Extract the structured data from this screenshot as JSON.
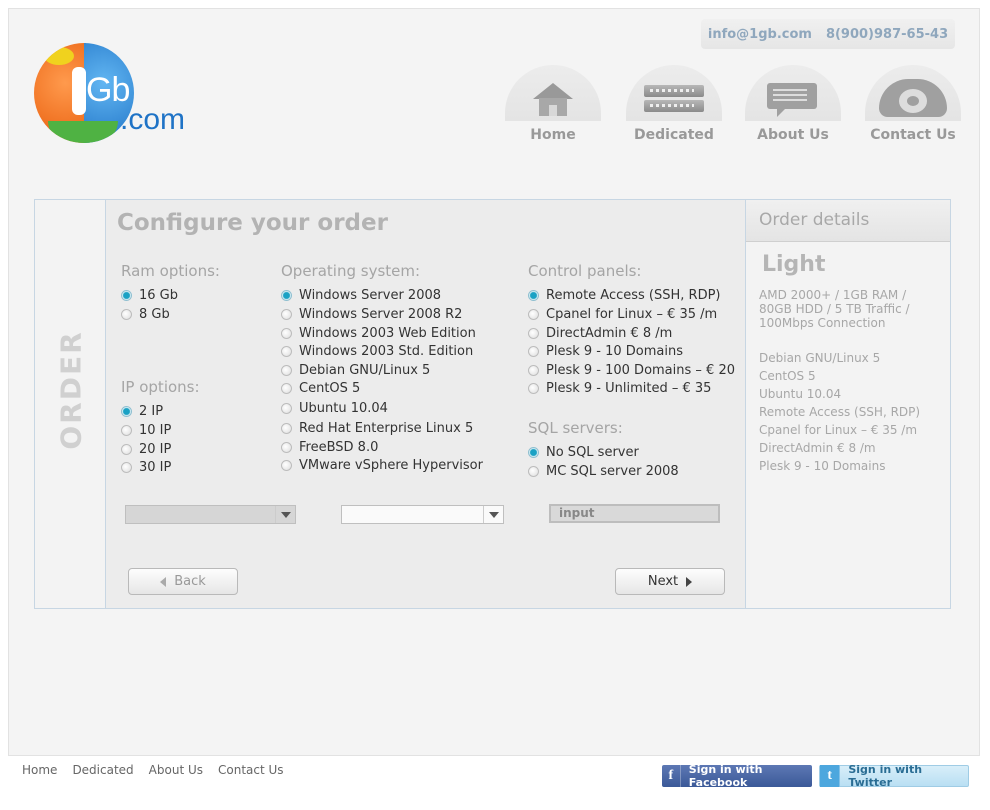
{
  "header": {
    "email": "info@1gb.com",
    "phone": "8(900)987-65-43",
    "logo_text": "1Gb.com",
    "nav": [
      {
        "label": "Home",
        "icon": "home-icon"
      },
      {
        "label": "Dedicated",
        "icon": "server-icon"
      },
      {
        "label": "About Us",
        "icon": "chat-icon"
      },
      {
        "label": "Contact Us",
        "icon": "phone-icon"
      }
    ]
  },
  "order": {
    "side_label": "ORDER",
    "title": "Configure your order",
    "ram": {
      "title": "Ram options:",
      "options": [
        {
          "label": "16 Gb",
          "selected": true
        },
        {
          "label": "8 Gb",
          "selected": false
        }
      ]
    },
    "ip": {
      "title": "IP options:",
      "options": [
        {
          "label": "2 IP",
          "selected": true
        },
        {
          "label": "10 IP",
          "selected": false
        },
        {
          "label": "20 IP",
          "selected": false
        },
        {
          "label": "30 IP",
          "selected": false
        }
      ]
    },
    "os": {
      "title": "Operating system:",
      "options": [
        {
          "label": "Windows Server 2008",
          "selected": true
        },
        {
          "label": "Windows Server 2008 R2",
          "selected": false
        },
        {
          "label": "Windows 2003 Web Edition",
          "selected": false
        },
        {
          "label": "Windows 2003 Std. Edition",
          "selected": false
        },
        {
          "label": "Debian GNU/Linux 5",
          "selected": false
        },
        {
          "label": "CentOS 5",
          "selected": false
        },
        {
          "label": "Ubuntu 10.04",
          "selected": false
        },
        {
          "label": "Red Hat Enterprise Linux 5",
          "selected": false
        },
        {
          "label": "FreeBSD 8.0",
          "selected": false
        },
        {
          "label": "VMware vSphere Hypervisor",
          "selected": false
        }
      ]
    },
    "control": {
      "title": "Control panels:",
      "options": [
        {
          "label": "Remote Access (SSH, RDP)",
          "selected": true
        },
        {
          "label": "Cpanel for Linux – € 35 /m",
          "selected": false
        },
        {
          "label": "DirectAdmin € 8 /m",
          "selected": false
        },
        {
          "label": "Plesk 9 - 10 Domains",
          "selected": false
        },
        {
          "label": "Plesk 9 - 100 Domains – € 20",
          "selected": false
        },
        {
          "label": "Plesk 9 - Unlimited – € 35",
          "selected": false
        }
      ]
    },
    "sql": {
      "title": "SQL servers:",
      "options": [
        {
          "label": "No SQL server",
          "selected": true
        },
        {
          "label": "MC SQL server 2008",
          "selected": false
        }
      ]
    },
    "input_placeholder": "input",
    "back_label": "Back",
    "next_label": "Next"
  },
  "details": {
    "title": "Order details",
    "plan": "Light",
    "spec": "AMD 2000+  / 1GB RAM / 80GB HDD / 5 TB Traffic / 100Mbps Connection",
    "lines": [
      "Debian GNU/Linux 5",
      "CentOS 5",
      "Ubuntu 10.04",
      "Remote Access (SSH, RDP)",
      "Cpanel for Linux – € 35 /m",
      "DirectAdmin € 8 /m",
      "Plesk 9 - 10 Domains"
    ]
  },
  "footer": {
    "links": [
      "Home",
      "Dedicated",
      "About Us",
      "Contact Us"
    ],
    "facebook_label": "Sign in with Facebook",
    "facebook_icon": "f",
    "twitter_label": "Sign in with Twitter",
    "twitter_icon": "t"
  }
}
